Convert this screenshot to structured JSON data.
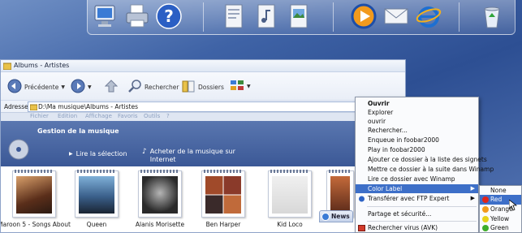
{
  "dock": {
    "icons": [
      "computer-icon",
      "printer-icon",
      "help-icon",
      "documents-icon",
      "music-folder-icon",
      "pictures-folder-icon",
      "media-player-icon",
      "mail-icon",
      "internet-explorer-icon",
      "recycle-bin-icon"
    ]
  },
  "window": {
    "title": "Albums - Artistes",
    "toolbar": {
      "back_label": "Précédente",
      "search_label": "Rechercher",
      "folders_label": "Dossiers"
    },
    "address": {
      "label": "Adresse",
      "value": "D:\\Ma musique\\Albums - Artistes"
    },
    "faint_menu": [
      "Fichier",
      "Edition",
      "Affichage",
      "Favoris",
      "Outils",
      "?"
    ],
    "task_panel": {
      "title": "Gestion de la musique",
      "links": [
        "Lire la sélection",
        "Acheter de la musique sur Internet"
      ]
    },
    "albums": [
      {
        "label": "Maroon 5 - Songs About"
      },
      {
        "label": "Queen"
      },
      {
        "label": "Alanis Morisette"
      },
      {
        "label": "Ben Harper"
      },
      {
        "label": "Kid Loco"
      }
    ]
  },
  "context_menu": {
    "items": [
      {
        "label": "Ouvrir"
      },
      {
        "label": "Explorer"
      },
      {
        "label": "ouvrir"
      },
      {
        "label": "Rechercher..."
      },
      {
        "label": "Enqueue in foobar2000"
      },
      {
        "label": "Play in foobar2000"
      },
      {
        "label": "Ajouter ce dossier à la liste des signets"
      },
      {
        "label": "Mettre ce dossier à la suite dans Winamp"
      },
      {
        "label": "Lire ce dossier avec Winamp"
      },
      {
        "label": "Color Label"
      },
      {
        "label": "Transférer avec FTP Expert"
      },
      {
        "label": "Partage et sécurité..."
      },
      {
        "label": "Rechercher virus (AVK)"
      }
    ]
  },
  "color_submenu": {
    "items": [
      {
        "label": "None",
        "color": ""
      },
      {
        "label": "Red",
        "color": "#e0241b"
      },
      {
        "label": "Orange",
        "color": "#f29a1d"
      },
      {
        "label": "Yellow",
        "color": "#e8d21a"
      },
      {
        "label": "Green",
        "color": "#3fae2a"
      }
    ],
    "selected": "Red"
  },
  "news_tab": {
    "label": "News"
  },
  "colors": {
    "highlight": "#3d6fc8",
    "panel": "#3b5896"
  }
}
